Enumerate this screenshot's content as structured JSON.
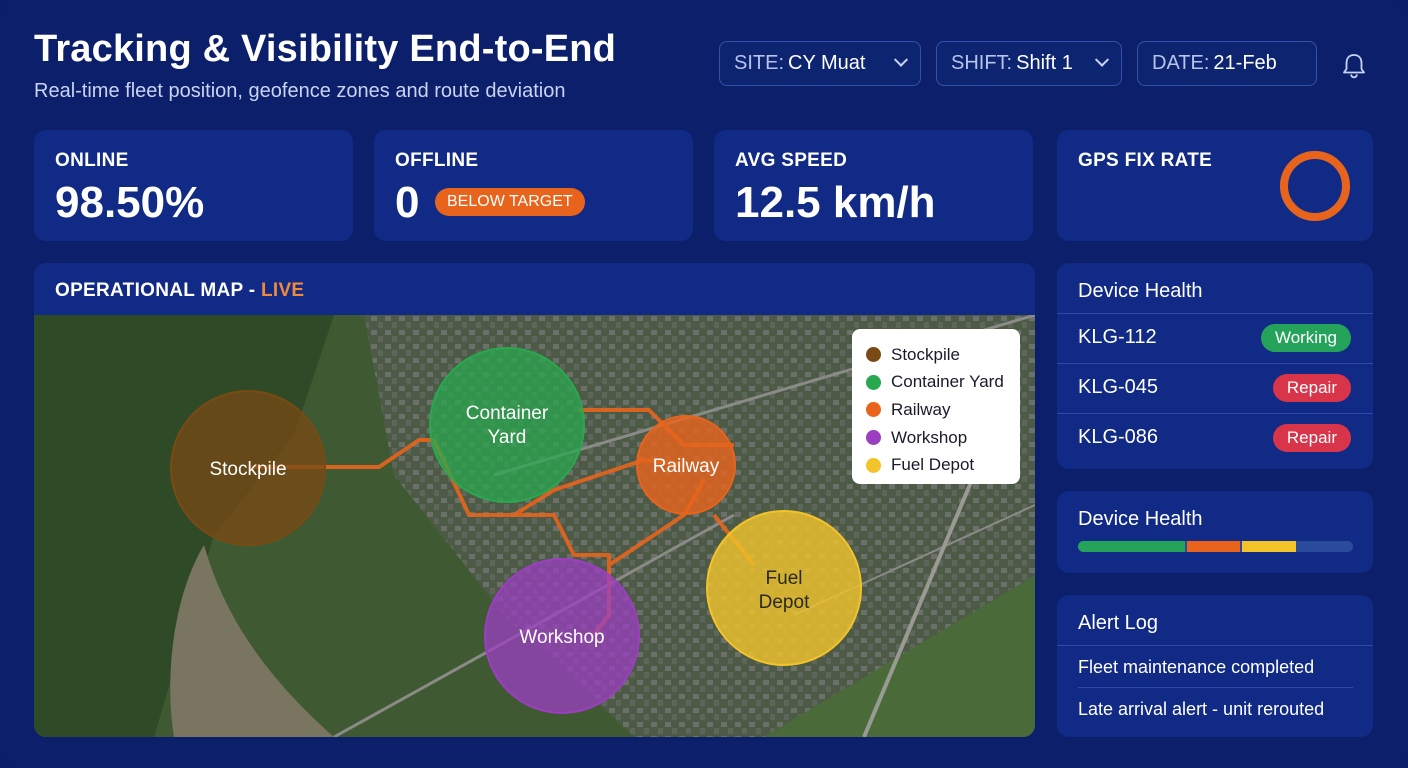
{
  "header": {
    "title": "Tracking & Visibility End-to-End",
    "subtitle": "Real-time fleet position, geofence zones and route deviation"
  },
  "filters": {
    "site": {
      "label": "SITE:",
      "value": "CY Muat"
    },
    "shift": {
      "label": "SHIFT:",
      "value": "Shift 1"
    },
    "date": {
      "label": "DATE:",
      "value": "21-Feb"
    }
  },
  "icons": {
    "notifications": "bell-icon",
    "dropdown": "chevron-down-icon"
  },
  "kpis": {
    "online": {
      "label": "ONLINE",
      "value": "98.50%"
    },
    "offline": {
      "label": "OFFLINE",
      "value": "0",
      "badge": "BELOW TARGET"
    },
    "avg_speed": {
      "label": "AVG SPEED",
      "value": "12.5 km/h"
    },
    "gps_fix": {
      "label": "GPS FIX RATE",
      "gauge_fraction": 1.0,
      "gauge_color": "#e8641c"
    }
  },
  "map": {
    "title": "OPERATIONAL MAP - ",
    "live": "LIVE",
    "zones": [
      {
        "name": "Stockpile",
        "color": "#7a4a14"
      },
      {
        "name": "Container Yard",
        "color": "#2aa84f"
      },
      {
        "name": "Railway",
        "color": "#e8641c"
      },
      {
        "name": "Workshop",
        "color": "#9b3fc1"
      },
      {
        "name": "Fuel Depot",
        "color": "#f2c42a"
      }
    ],
    "labels": {
      "stockpile": "Stockpile",
      "container_line1": "Container",
      "container_line2": "Yard",
      "railway": "Railway",
      "workshop": "Workshop",
      "fuel_line1": "Fuel",
      "fuel_line2": "Depot"
    },
    "route_color": "#e8641c"
  },
  "device_health": {
    "title": "Device Health",
    "devices": [
      {
        "id": "KLG-112",
        "status": "Working"
      },
      {
        "id": "KLG-045",
        "status": "Repair"
      },
      {
        "id": "KLG-086",
        "status": "Repair"
      }
    ]
  },
  "device_health_bar": {
    "title": "Device Health",
    "segments": [
      {
        "fraction": 0.4,
        "color": "#25a35a"
      },
      {
        "fraction": 0.2,
        "color": "#e8641c"
      },
      {
        "fraction": 0.2,
        "color": "#f2c42a"
      },
      {
        "fraction": 0.2,
        "color": "#2a4a9c"
      }
    ]
  },
  "alert_log": {
    "title": "Alert Log",
    "items": [
      "Fleet maintenance completed",
      "Late arrival alert - unit rerouted"
    ]
  }
}
